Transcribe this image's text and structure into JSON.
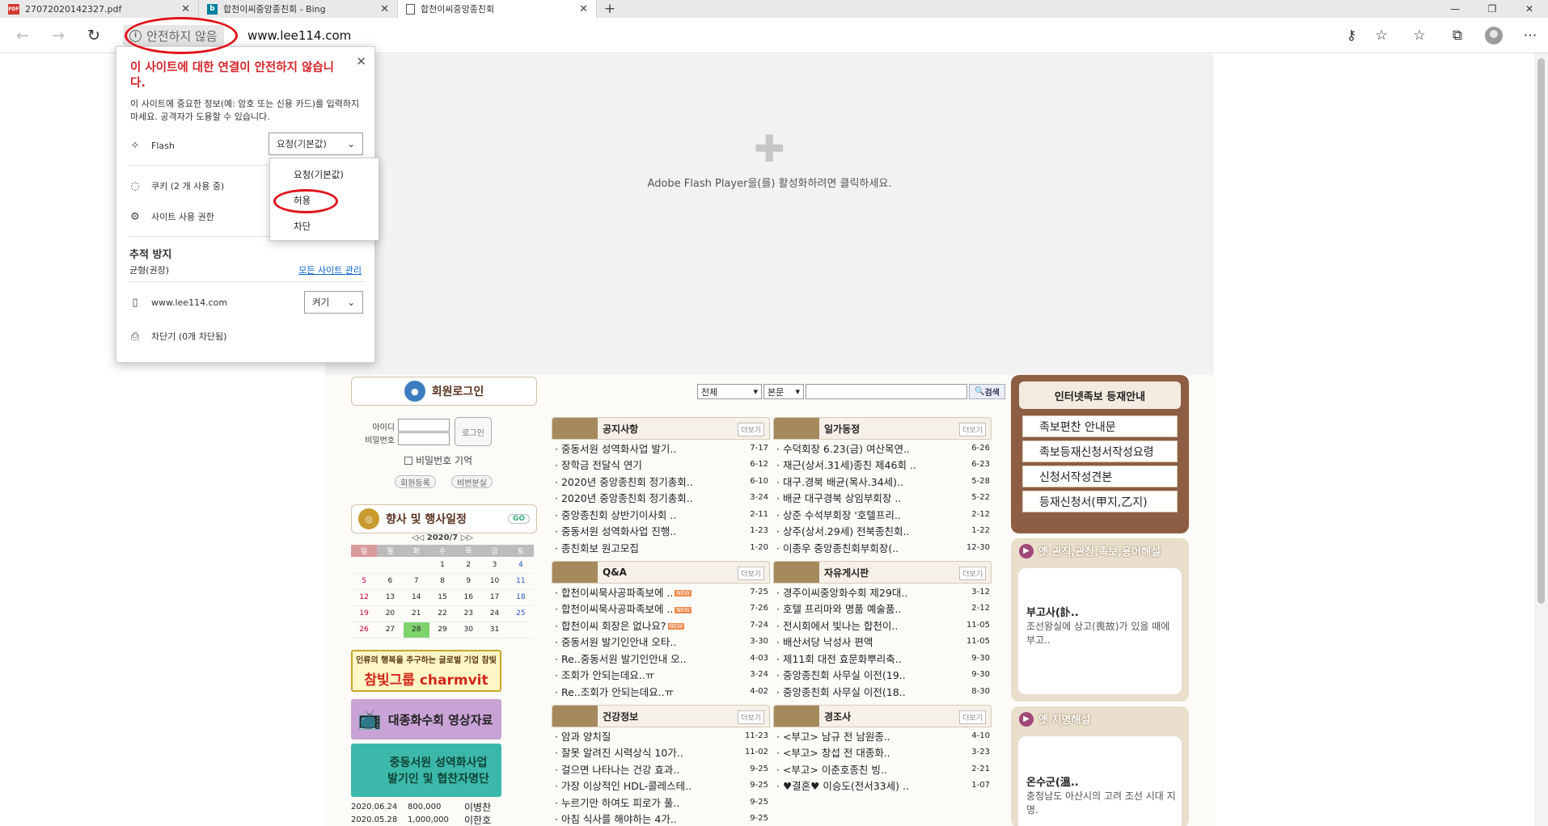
{
  "browser": {
    "tabs": [
      {
        "title": "27072020142327.pdf",
        "favicon": "PDF"
      },
      {
        "title": "합천이씨중앙종친회 - Bing",
        "favicon": "b"
      },
      {
        "title": "합천이씨중앙종친회",
        "favicon": ""
      }
    ],
    "security_label": "안전하지 않음",
    "url": "www.lee114.com"
  },
  "flash": {
    "message": "Adobe Flash Player을(를) 활성화하려면 클릭하세요."
  },
  "popup": {
    "title": "이 사이트에 대한 연결이 안전하지 않습니다.",
    "description": "이 사이트에 중요한 정보(예: 암호 또는 신용 카드)를 입력하지 마세요. 공격자가 도용할 수 있습니다.",
    "flash_label": "Flash",
    "flash_value": "요청(기본값)",
    "cookies_label": "쿠키 (2 개 사용 중)",
    "site_permissions_label": "사이트 사용 권한",
    "tracking_title": "추적 방지",
    "tracking_level": "균형(권장)",
    "manage_all_sites": "모든 사이트 관리",
    "site_label": "www.lee114.com",
    "site_toggle": "켜기",
    "blocker_label": "차단기 (0개 차단됨)"
  },
  "dropdown": {
    "options": [
      "요청(기본값)",
      "허용",
      "차단"
    ]
  },
  "site": {
    "login": {
      "header": "회원로그인",
      "id_label": "아이디",
      "pw_label": "비밀번호",
      "login_button": "로그인",
      "remember_label": "비밀번호 기억",
      "register_button": "회원등록",
      "find_pw_button": "비번분실"
    },
    "events_header": "향사 및 행사일정",
    "events_go": "GO",
    "calendar": {
      "month": "2020/7",
      "days": [
        "일",
        "월",
        "화",
        "수",
        "목",
        "금",
        "토"
      ],
      "weeks": [
        [
          "",
          "",
          "",
          "1",
          "2",
          "3",
          "4"
        ],
        [
          "5",
          "6",
          "7",
          "8",
          "9",
          "10",
          "11"
        ],
        [
          "12",
          "13",
          "14",
          "15",
          "16",
          "17",
          "18"
        ],
        [
          "19",
          "20",
          "21",
          "22",
          "23",
          "24",
          "25"
        ],
        [
          "26",
          "27",
          "28",
          "29",
          "30",
          "31",
          ""
        ]
      ]
    },
    "banners": {
      "charmvit_tag": "인류의 행복을 추구하는 글로벌 기업 참빛",
      "charmvit_name": "참빛그룹 charmvit",
      "video": "대종화수회 영상자료",
      "donation_line1": "중동서원 성역화사업",
      "donation_line2": "발기인 및 협찬자명단"
    },
    "donations": [
      {
        "date": "2020.06.24",
        "amount": "800,000",
        "name": "이병찬"
      },
      {
        "date": "2020.05.28",
        "amount": "1,000,000",
        "name": "이한호"
      }
    ],
    "search": {
      "scope": "전체",
      "field": "본문",
      "button": "검색"
    },
    "more_label": "더보기",
    "boards": {
      "notice": {
        "title": "공지사항",
        "items": [
          {
            "t": "중동서원 성역화사업 발기..",
            "d": "7-17"
          },
          {
            "t": "장학금 전달식 연기",
            "d": "6-12"
          },
          {
            "t": "2020년 중앙종친회 정기총회..",
            "d": "6-10"
          },
          {
            "t": "2020년 중앙종친회 정기총회..",
            "d": "3-24"
          },
          {
            "t": "중앙종친회 상반기이사회 ..",
            "d": "2-11"
          },
          {
            "t": "중동서원 성역화사업 진행..",
            "d": "1-23"
          },
          {
            "t": "종친회보 원고모집",
            "d": "1-20"
          }
        ]
      },
      "family": {
        "title": "일가동정",
        "items": [
          {
            "t": "수덕회장 6.23(금) 여산목연..",
            "d": "6-26"
          },
          {
            "t": "재근(상서.31세)종친 제46회 ..",
            "d": "6-23"
          },
          {
            "t": "대구.경북 배균(목사.34세)..",
            "d": "5-28"
          },
          {
            "t": "배균 대구경북 상임부회장 ..",
            "d": "5-22"
          },
          {
            "t": "상준 수석부회장 '호텔프리..",
            "d": "2-12"
          },
          {
            "t": "상주(상서.29세) 전북종친회..",
            "d": "1-22"
          },
          {
            "t": "이종우 중앙종친회부회장(..",
            "d": "12-30"
          }
        ]
      },
      "qa": {
        "title": "Q&A",
        "items": [
          {
            "t": "합천이씨묵사공파족보에 ..",
            "d": "7-25",
            "new": true
          },
          {
            "t": "합천이씨묵사공파족보에 ..",
            "d": "7-26",
            "new": true
          },
          {
            "t": "합천이씨 회장은 없나요?",
            "d": "7-24",
            "new": true
          },
          {
            "t": "중동서원 발기인안내 오타..",
            "d": "3-30"
          },
          {
            "t": "Re..중동서원 발기인안내 오..",
            "d": "4-03"
          },
          {
            "t": "조회가 안되는데요..ㅠ",
            "d": "3-24"
          },
          {
            "t": "Re..조회가 안되는데요..ㅠ",
            "d": "4-02"
          }
        ]
      },
      "free": {
        "title": "자유게시판",
        "items": [
          {
            "t": "경주이씨중앙화수회 제29대..",
            "d": "3-12"
          },
          {
            "t": "호텔 프리마와 명품 예술품..",
            "d": "2-12"
          },
          {
            "t": "전시회에서 빛나는 합천이..",
            "d": "11-05"
          },
          {
            "t": "배산서당 낙성사 편액",
            "d": "11-05"
          },
          {
            "t": "제11회 대전 효문화뿌리축..",
            "d": "9-30"
          },
          {
            "t": "중앙종친회 사무실 이전(19..",
            "d": "9-30"
          },
          {
            "t": "중앙종친회 사무실 이전(18..",
            "d": "8-30"
          }
        ]
      },
      "health": {
        "title": "건강정보",
        "items": [
          {
            "t": "암과 양치질",
            "d": "11-23"
          },
          {
            "t": "잘못 알려진 시력상식 10가..",
            "d": "11-02"
          },
          {
            "t": "걸으면 나타나는 건강 효과..",
            "d": "9-25"
          },
          {
            "t": "가장 이상적인 HDL-콜레스테..",
            "d": "9-25"
          },
          {
            "t": "누르기만 하여도 피로가 풀..",
            "d": "9-25"
          },
          {
            "t": "아침 식사를 해야하는 4가..",
            "d": "9-25"
          }
        ]
      },
      "events": {
        "title": "경조사",
        "items": [
          {
            "t": "<부고> 남규 전 남원종..",
            "d": "4-10"
          },
          {
            "t": "<부고> 창섭 전 대종화..",
            "d": "3-23"
          },
          {
            "t": "<부고> 이춘호종친 빙..",
            "d": "2-21"
          },
          {
            "t": "♥결혼♥ 이승도(전서33세) ..",
            "d": "1-07"
          }
        ]
      }
    },
    "right": {
      "genealogy_title": "인터넷족보 등재안내",
      "genealogy_links": [
        "족보편찬 안내문",
        "족보등재신청서작성요령",
        "신청서작성견본",
        "등재신청서(甲지,乙지)"
      ],
      "terms_title": "옛 관직,관청,족보,용어해설",
      "terms_word": "부고사(訃..",
      "terms_desc": "조선왕실에 상고(喪故)가 있을 때에 부고..",
      "place_title": "옛 지명해설",
      "place_word": "온수군(溫..",
      "place_desc": "충청남도 아산시의 고려 조선 시대 지명."
    }
  }
}
